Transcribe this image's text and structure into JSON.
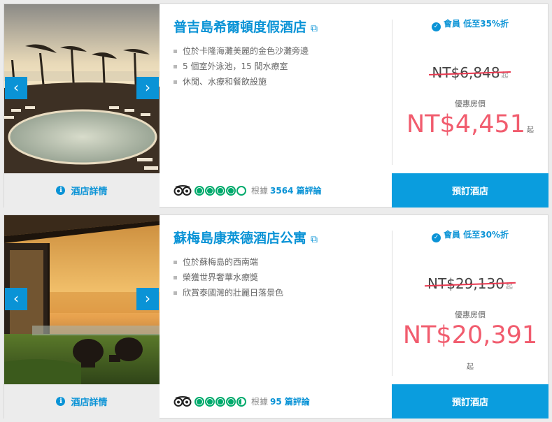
{
  "hotels": [
    {
      "name": "普吉島希爾頓度假酒店",
      "features": [
        "位於卡隆海灘美麗的金色沙灘旁邊",
        "5 個室外泳池，15 間水療室",
        "休閒、水療和餐飲設施"
      ],
      "details_label": "酒店詳情",
      "rating_bubbles": 4,
      "review_prefix": "根據",
      "review_link": "3564 篇評論",
      "member_label": "會員 低至35%折",
      "original_price": "NT$6,848",
      "original_unit": "起",
      "discount_label": "優惠房價",
      "price": "NT$4,451",
      "price_unit": "起",
      "book_label": "預訂酒店"
    },
    {
      "name": "蘇梅島康萊德酒店公寓",
      "features": [
        "位於蘇梅島的西南端",
        "榮獲世界奢華水療獎",
        "欣賞泰國灣的壯麗日落景色"
      ],
      "details_label": "酒店詳情",
      "rating_bubbles": 4.5,
      "review_prefix": "根據",
      "review_link": "95 篇評論",
      "member_label": "會員 低至30%折",
      "original_price": "NT$29,130",
      "original_unit": "起",
      "discount_label": "優惠房價",
      "price": "NT$20,391",
      "price_unit": "起",
      "book_label": "預訂酒店"
    }
  ],
  "icons": {
    "arrow_left": "chevron-left-icon",
    "arrow_right": "chevron-right-icon",
    "info": "info-icon",
    "external": "external-link-icon",
    "check": "check-circle-icon",
    "owl": "tripadvisor-owl-icon"
  },
  "colors": {
    "accent": "#0a93d6",
    "price": "#f15c6e",
    "rating": "#00aa6c",
    "strike": "#e8384f"
  }
}
